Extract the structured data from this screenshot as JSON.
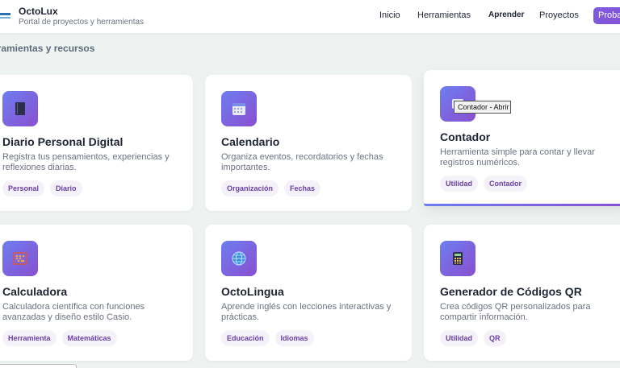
{
  "header": {
    "brand_name": "OctoLux",
    "brand_sub": "Portal de proyectos y herramientas",
    "nav": {
      "inicio": "Inicio",
      "herramientas": "Herramientas",
      "aprender": "Aprender",
      "proyectos": "Proyectos"
    },
    "cta": "Proba"
  },
  "section_title": "rramientas y recursos",
  "tooltip": "Contador - Abrir",
  "colors": {
    "accent_start": "#6d7df0",
    "accent_end": "#8a4fd0",
    "tag_text": "#6b3fa8",
    "background": "#eef3f1"
  },
  "cards": [
    {
      "title": "Diario Personal Digital",
      "desc": "Registra tus pensamientos, experiencias y reflexiones diarias.",
      "tags": [
        "Personal",
        "Diario"
      ],
      "icon": "journal-icon"
    },
    {
      "title": "Calendario",
      "desc": "Organiza eventos, recordatorios y fechas importantes.",
      "tags": [
        "Organización",
        "Fechas"
      ],
      "icon": "calendar-icon"
    },
    {
      "title": "Contador",
      "desc": "Herramienta simple para contar y llevar registros numéricos.",
      "tags": [
        "Utilidad",
        "Contador"
      ],
      "icon": "counter-icon"
    },
    {
      "title": "Calculadora",
      "desc": "Calculadora científica con funciones avanzadas y diseño estilo Casio.",
      "tags": [
        "Herramienta",
        "Matemáticas"
      ],
      "icon": "abacus-icon"
    },
    {
      "title": "OctoLingua",
      "desc": "Aprende inglés con lecciones interactivas y prácticas.",
      "tags": [
        "Educación",
        "Idiomas"
      ],
      "icon": "globe-icon"
    },
    {
      "title": "Generador de Códigos QR",
      "desc": "Crea códigos QR personalizados para compartir información.",
      "tags": [
        "Utilidad",
        "QR"
      ],
      "icon": "calculator-icon"
    }
  ]
}
